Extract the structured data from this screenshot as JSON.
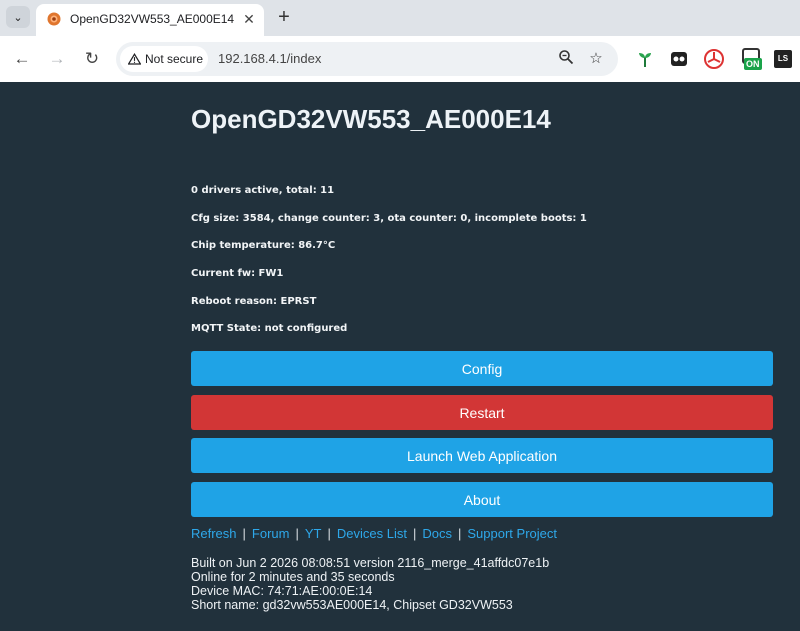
{
  "browser": {
    "tab_title": "OpenGD32VW553_AE000E14",
    "security_label": "Not secure",
    "url": "192.168.4.1/index",
    "extension_badge": "ON",
    "extension_ls": "LS"
  },
  "page": {
    "title": "OpenGD32VW553_AE000E14",
    "info": [
      "0 drivers active, total: 11",
      "Cfg size: 3584, change counter: 3, ota counter: 0, incomplete boots: 1",
      "Chip temperature: 86.7°C",
      "Current fw: FW1",
      "Reboot reason: EPRST",
      "MQTT State: not configured"
    ],
    "buttons": {
      "config": "Config",
      "restart": "Restart",
      "launch": "Launch Web Application",
      "about": "About"
    },
    "links": {
      "refresh": "Refresh",
      "forum": "Forum",
      "yt": "YT",
      "devices": "Devices List",
      "docs": "Docs",
      "support": "Support Project",
      "separator": "|"
    },
    "footer": [
      "Built on Jun 2 2026 08:08:51 version 2116_merge_41affdc07e1b",
      "Online for 2 minutes and 35 seconds",
      "Device MAC: 74:71:AE:00:0E:14",
      "Short name: gd32vw553AE000E14, Chipset GD32VW553"
    ]
  },
  "colors": {
    "background": "#21313c",
    "button_blue": "#1fa3e6",
    "button_red": "#d23636",
    "link": "#2ea8ea"
  }
}
